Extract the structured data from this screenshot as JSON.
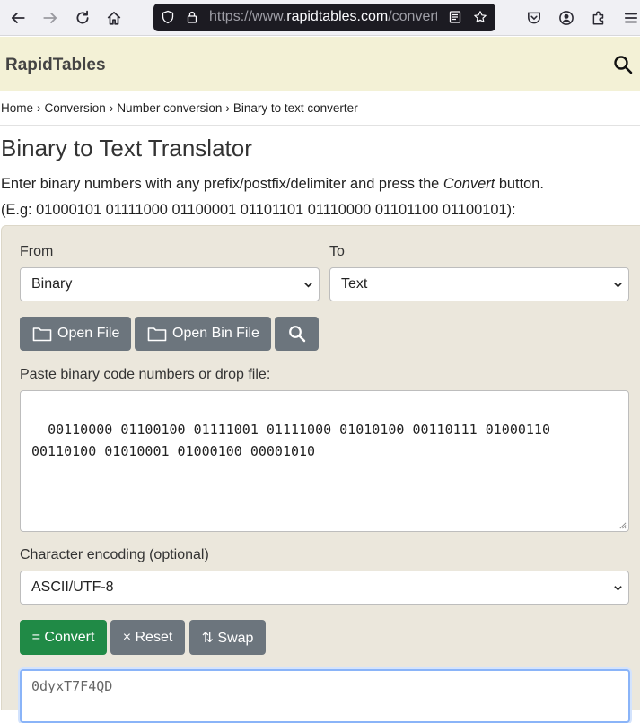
{
  "browser": {
    "url_prefix": "https://www.",
    "url_domain": "rapidtables.com",
    "url_rest": "/convert/number/binary-to-ascii.html",
    "icons": [
      "back-icon",
      "forward-icon",
      "reload-icon",
      "home-icon",
      "shield-icon",
      "lock-icon",
      "reader-view-icon",
      "bookmark-star-icon",
      "pocket-icon",
      "account-icon",
      "extensions-icon",
      "menu-icon"
    ]
  },
  "site": {
    "logo": "RapidTables"
  },
  "breadcrumb": {
    "items": [
      "Home",
      "Conversion",
      "Number conversion",
      "Binary to text converter"
    ],
    "separator": "›"
  },
  "page": {
    "title": "Binary to Text Translator",
    "intro_before": "Enter binary numbers with any prefix/postfix/delimiter and press the ",
    "intro_em": "Convert",
    "intro_after": " button.",
    "example": "(E.g: 01000101 01111000 01100001 01101101 01110000 01101100 01100101):"
  },
  "form": {
    "from_label": "From",
    "from_value": "Binary",
    "to_label": "To",
    "to_value": "Text",
    "open_file": "Open File",
    "open_bin_file": "Open Bin File",
    "input_label": "Paste binary code numbers or drop file:",
    "input_value": "00110000 01100100 01111001 01111000 01010100 00110111 01000110\n00110100 01010001 01000100 00001010",
    "encoding_label": "Character encoding (optional)",
    "encoding_value": "ASCII/UTF-8",
    "convert": "= Convert",
    "reset": "× Reset",
    "swap": "⇅ Swap",
    "output_value": "0dyxT7F4QD"
  },
  "colors": {
    "header_bg": "#f3f1d6",
    "panel_bg": "#ebe7dc",
    "convert_green": "#208a46",
    "gray_button": "#6c757d",
    "url_bar": "#1c1b22"
  }
}
